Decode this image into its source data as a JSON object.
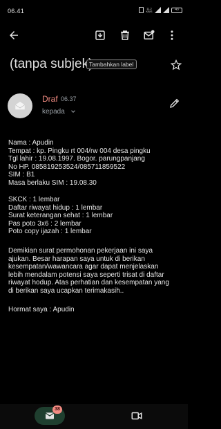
{
  "status_bar": {
    "time": "06.41",
    "speed": "11,2 KB/S",
    "battery": "43"
  },
  "toolbar": {
    "icons": [
      "back-arrow-icon",
      "archive-icon",
      "delete-icon",
      "mark-unread-icon",
      "more-vert-icon"
    ]
  },
  "email": {
    "subject": "(tanpa subjek)",
    "label_chip": "Tambahkan label",
    "sender": "Draf",
    "time": "06.37",
    "recipient_label": "kepada"
  },
  "body": {
    "identity": [
      "Nama : Apudin",
      "Tempat : kp. Pingku rt 004/rw 004 desa pingku",
      "Tgl lahir : 19.08.1997. Bogor. parungpanjang",
      "No HP. 085819253524/085711859522",
      "SIM : B1",
      "Masa berlaku SIM : 19.08.30"
    ],
    "documents": [
      "SKCK : 1 lembar",
      "Daftar riwayat hidup : 1 lembar",
      "Surat keterangan sehat : 1 lembar",
      "Pas poto 3x6 : 2 lembar",
      "Poto copy ijazah : 1 lembar"
    ],
    "paragraph": [
      "Demikian surat permohonan pekerjaan ini saya",
      "ajukan. Besar harapan saya untuk di berikan",
      "kesempatan/wawancara agar dapat menjelaskan",
      "lebih mendalam potensi saya seperti trisat di daftar",
      "riwayat hodup. Atas perhatian dan kesempatan yang",
      "di berikan saya ucapkan terimakasih.."
    ],
    "closing": "Hormat saya : Apudin"
  },
  "bottom_nav": {
    "mail_badge": "38"
  },
  "colors": {
    "background": "#000000",
    "draft_red": "#f28b82",
    "nav_pill": "#1f3f2f"
  }
}
